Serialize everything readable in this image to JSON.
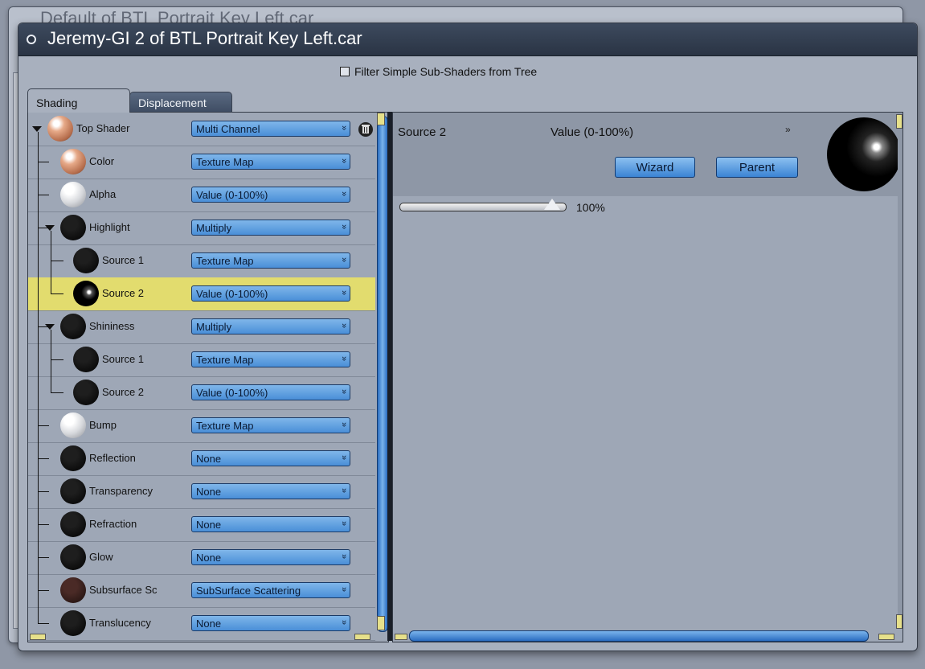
{
  "background_window": {
    "title": "Default of BTL Portrait Key Left.car"
  },
  "window": {
    "title": "Jeremy-GI 2 of BTL Portrait Key Left.car"
  },
  "filter": {
    "label": "Filter Simple Sub-Shaders from Tree",
    "checked": false
  },
  "tabs": [
    {
      "label": "Shading",
      "active": true
    },
    {
      "label": "Displacement",
      "active": false
    }
  ],
  "tree": [
    {
      "label": "Top Shader",
      "value": "Multi Channel",
      "depth": 0,
      "ball": "skin",
      "expanded": true
    },
    {
      "label": "Color",
      "value": "Texture Map",
      "depth": 1,
      "ball": "skin"
    },
    {
      "label": "Alpha",
      "value": "Value (0-100%)",
      "depth": 1,
      "ball": "white"
    },
    {
      "label": "Highlight",
      "value": "Multiply",
      "depth": 1,
      "ball": "black",
      "expanded": true
    },
    {
      "label": "Source 1",
      "value": "Texture Map",
      "depth": 2,
      "ball": "black"
    },
    {
      "label": "Source 2",
      "value": "Value (0-100%)",
      "depth": 2,
      "ball": "black-hl",
      "selected": true
    },
    {
      "label": "Shininess",
      "value": "Multiply",
      "depth": 1,
      "ball": "black",
      "expanded": true
    },
    {
      "label": "Source 1",
      "value": "Texture Map",
      "depth": 2,
      "ball": "black"
    },
    {
      "label": "Source 2",
      "value": "Value (0-100%)",
      "depth": 2,
      "ball": "black"
    },
    {
      "label": "Bump",
      "value": "Texture Map",
      "depth": 1,
      "ball": "white"
    },
    {
      "label": "Reflection",
      "value": "None",
      "depth": 1,
      "ball": "black"
    },
    {
      "label": "Transparency",
      "value": "None",
      "depth": 1,
      "ball": "black"
    },
    {
      "label": "Refraction",
      "value": "None",
      "depth": 1,
      "ball": "black"
    },
    {
      "label": "Glow",
      "value": "None",
      "depth": 1,
      "ball": "black"
    },
    {
      "label": "Subsurface Sc",
      "value": "SubSurface Scattering",
      "depth": 1,
      "ball": "dark-red"
    },
    {
      "label": "Translucency",
      "value": "None",
      "depth": 1,
      "ball": "black"
    }
  ],
  "detail": {
    "name": "Source 2",
    "type": "Value (0-100%)",
    "wizard_label": "Wizard",
    "parent_label": "Parent",
    "slider_value_text": "100%",
    "slider_fraction": 1.0
  },
  "icons": {
    "close": "close-icon",
    "trash": "trash-icon",
    "chevron": "chevron-down-icon",
    "expand": "expand-arrow-icon"
  },
  "colors": {
    "selected_row": "#e2dc6e",
    "dropdown": "#4a8fd8",
    "titlebar": "#2a3444"
  }
}
